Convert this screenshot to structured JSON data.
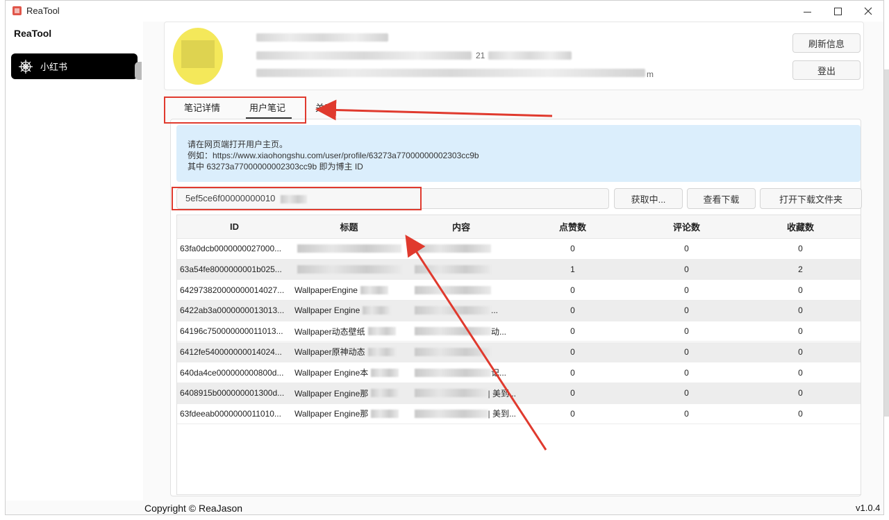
{
  "window": {
    "title": "ReaTool"
  },
  "sidebar": {
    "brand": "ReaTool",
    "items": [
      {
        "label": "小红书",
        "icon": "spiderweb-icon"
      }
    ]
  },
  "profile": {
    "stats_fragment": "21",
    "suffix_fragment": "m",
    "buttons": {
      "refresh": "刷新信息",
      "logout": "登出"
    }
  },
  "tabs": [
    {
      "label": "笔记详情"
    },
    {
      "label": "用户笔记",
      "active": true
    },
    {
      "label": "关于"
    }
  ],
  "hint": {
    "line1": "请在网页端打开用户主页。",
    "line2": "例如：https://www.xiaohongshu.com/user/profile/63273a77000000002303cc9b",
    "line3": "其中 63273a77000000002303cc9b 即为博主 ID"
  },
  "input": {
    "value": "5ef5ce6f00000000010"
  },
  "actions": {
    "fetch": "获取中...",
    "view_download": "查看下载",
    "open_folder": "打开下载文件夹"
  },
  "table": {
    "headers": [
      "ID",
      "标题",
      "内容",
      "点赞数",
      "评论数",
      "收藏数"
    ],
    "rows": [
      {
        "id": "63fa0dcb0000000027000...",
        "title": "",
        "content": "",
        "likes": "0",
        "comments": "0",
        "collects": "0"
      },
      {
        "id": "63a54fe8000000001b025...",
        "title": "",
        "content": "",
        "likes": "1",
        "comments": "0",
        "collects": "2"
      },
      {
        "id": "642973820000000014027...",
        "title": "WallpaperEngine",
        "content": "",
        "likes": "0",
        "comments": "0",
        "collects": "0"
      },
      {
        "id": "6422ab3a0000000013013...",
        "title": "Wallpaper Engine",
        "content": "...",
        "likes": "0",
        "comments": "0",
        "collects": "0"
      },
      {
        "id": "64196c750000000011013...",
        "title": "Wallpaper动态壁纸",
        "content": "动...",
        "likes": "0",
        "comments": "0",
        "collects": "0"
      },
      {
        "id": "6412fe540000000014024...",
        "title": "Wallpaper原神动态",
        "content": "",
        "likes": "0",
        "comments": "0",
        "collects": "0"
      },
      {
        "id": "640da4ce000000000800d...",
        "title": "Wallpaper Engine本",
        "content": "记...",
        "likes": "0",
        "comments": "0",
        "collects": "0"
      },
      {
        "id": "6408915b000000001300d...",
        "title": "Wallpaper Engine那",
        "content": "| 美到...",
        "likes": "0",
        "comments": "0",
        "collects": "0"
      },
      {
        "id": "63fdeeab0000000011010...",
        "title": "Wallpaper Engine那",
        "content": "| 美到...",
        "likes": "0",
        "comments": "0",
        "collects": "0"
      }
    ]
  },
  "footer": {
    "copyright": "Copyright © ReaJason",
    "version": "v1.0.4"
  },
  "colors": {
    "annotation": "#e03a2e",
    "hint_bg": "#dbeefc",
    "nav_active_bg": "#000000"
  }
}
